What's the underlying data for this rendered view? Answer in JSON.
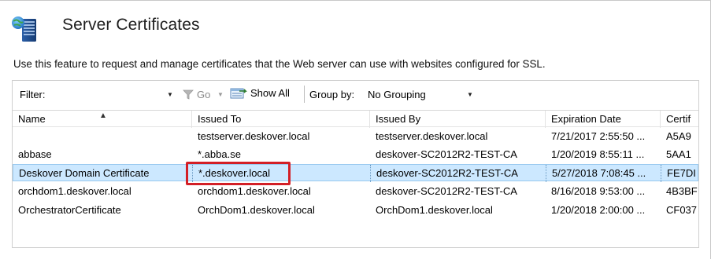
{
  "page": {
    "title": "Server Certificates",
    "description": "Use this feature to request and manage certificates that the Web server can use with websites configured for SSL.",
    "icon": "server-certificate-icon"
  },
  "toolbar": {
    "filter_label": "Filter:",
    "filter_value": "",
    "go_label": "Go",
    "show_all_label": "Show All",
    "group_by_label": "Group by:",
    "group_by_value": "No Grouping"
  },
  "table": {
    "columns": [
      "Name",
      "Issued To",
      "Issued By",
      "Expiration Date",
      "Certif"
    ],
    "sort_column": "Name",
    "rows": [
      [
        "",
        "testserver.deskover.local",
        "testserver.deskover.local",
        "7/21/2017 2:55:50 ...",
        "A5A9"
      ],
      [
        "abbase",
        "*.abba.se",
        "deskover-SC2012R2-TEST-CA",
        "1/20/2019 8:55:11 ...",
        "5AA1"
      ],
      [
        "Deskover Domain Certificate",
        "*.deskover.local",
        "deskover-SC2012R2-TEST-CA",
        "5/27/2018 7:08:45 ...",
        "FE7DI"
      ],
      [
        "orchdom1.deskover.local",
        "orchdom1.deskover.local",
        "deskover-SC2012R2-TEST-CA",
        "8/16/2018 9:53:00 ...",
        "4B3BF"
      ],
      [
        "OrchestratorCertificate",
        "OrchDom1.deskover.local",
        "OrchDom1.deskover.local",
        "1/20/2018 2:00:00 ...",
        "CF037"
      ]
    ],
    "selected_row": 2
  },
  "colors": {
    "selection_bg": "#cce8ff",
    "selection_border": "#99c9ef",
    "annotation_red": "#d31f26"
  }
}
